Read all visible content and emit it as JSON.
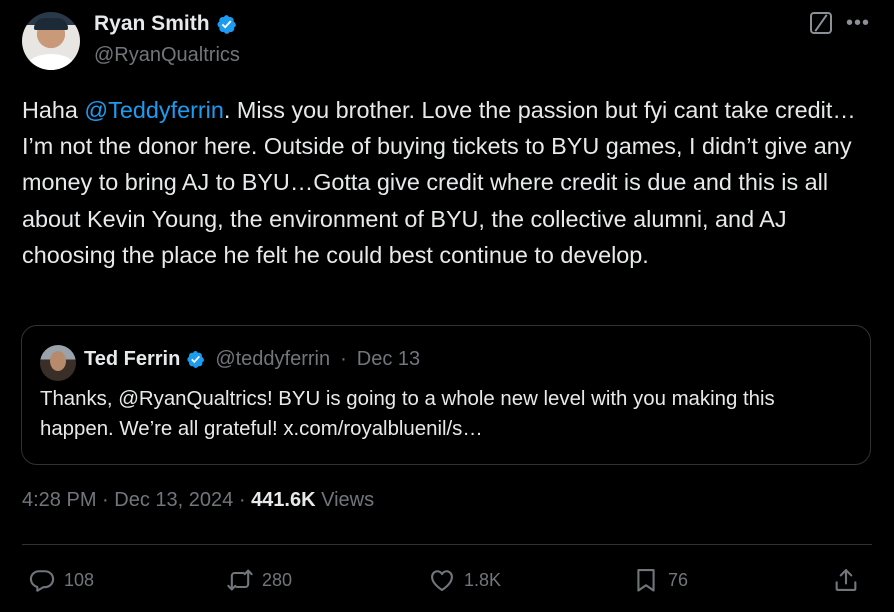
{
  "author": {
    "display_name": "Ryan Smith",
    "handle": "@RyanQualtrics",
    "verified": true,
    "verified_color": "#1d9bf0"
  },
  "tweet": {
    "text_before_mention": "Haha ",
    "mention": "@Teddyferrin",
    "text_after_mention": ". Miss you brother. Love the passion but fyi cant take credit…I’m not the donor here. Outside of buying tickets to BYU games, I didn’t give any money to bring AJ to BYU…Gotta give credit where credit is due and this is all about Kevin Young, the environment of BYU, the collective alumni, and AJ choosing the place he felt he could best continue to develop."
  },
  "quote": {
    "display_name": "Ted Ferrin",
    "handle": "@teddyferrin",
    "separator": "·",
    "date": "Dec 13",
    "text": "Thanks, @RyanQualtrics! BYU is going to a whole new level with you making this happen. We’re all grateful! x.com/royalbluenil/s…"
  },
  "meta": {
    "time": "4:28 PM",
    "sep1": "·",
    "date": "Dec 13, 2024",
    "sep2": "·",
    "views_count": "441.6K",
    "views_label": "Views"
  },
  "actions": {
    "replies": "108",
    "reposts": "280",
    "likes": "1.8K",
    "bookmarks": "76"
  },
  "icons": [
    "verified-badge-icon",
    "grok-icon",
    "more-icon",
    "reply-icon",
    "repost-icon",
    "like-icon",
    "bookmark-icon",
    "share-icon"
  ],
  "colors": {
    "background": "#000000",
    "text": "#e7e9ea",
    "muted": "#71767b",
    "accent": "#1d9bf0",
    "border": "#2f3336"
  }
}
